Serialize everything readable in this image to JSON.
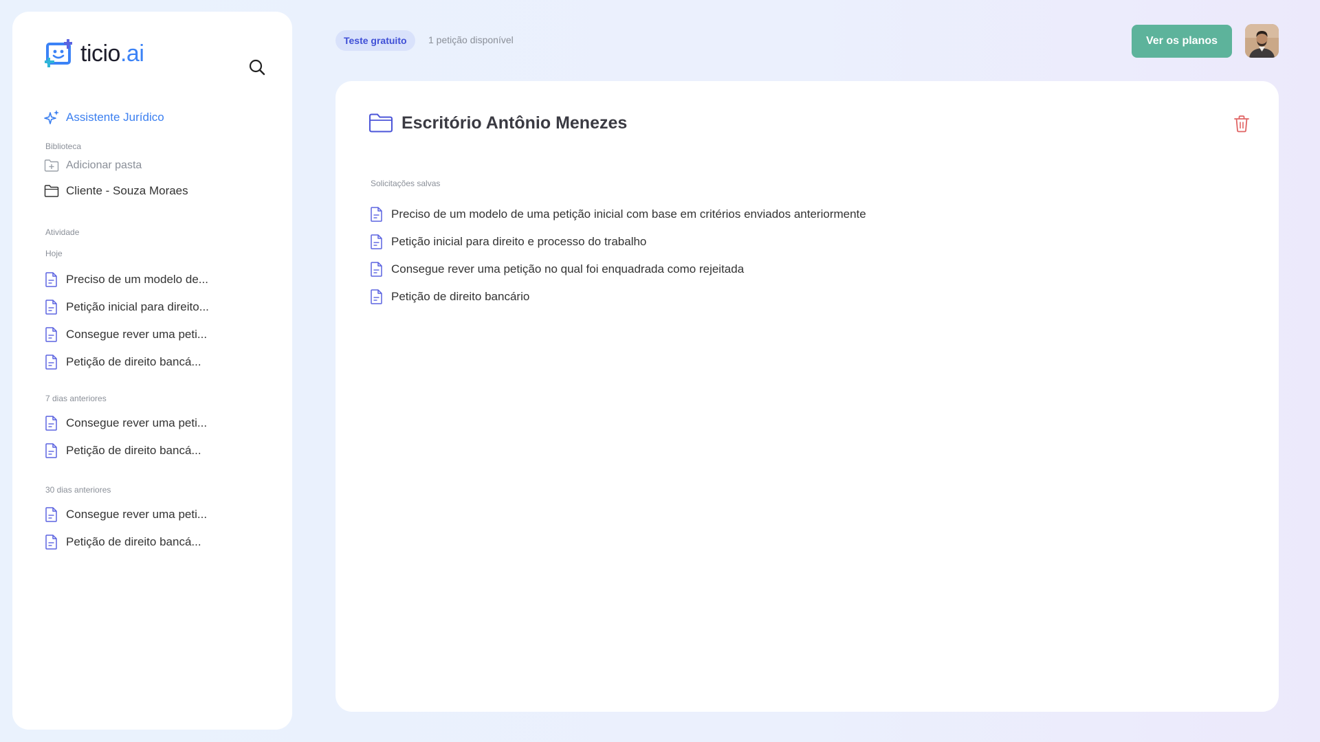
{
  "app": {
    "logo_text": "ticio",
    "logo_suffix": ".ai"
  },
  "colors": {
    "accent": "#3b7ff0",
    "doc_icon": "#5b63e0",
    "primary_button": "#5db39b",
    "danger": "#e06464",
    "badge_bg": "#d9e2fb",
    "badge_text": "#3f4fd6"
  },
  "sidebar": {
    "assistant_label": "Assistente Jurídico",
    "library_label": "Biblioteca",
    "add_folder_label": "Adicionar pasta",
    "folders": [
      "Cliente - Souza Moraes"
    ],
    "activity_label": "Atividade",
    "groups": [
      {
        "label": "Hoje",
        "items": [
          "Preciso de um modelo de...",
          "Petição inicial para direito...",
          "Consegue rever uma peti...",
          "Petição de direito bancá..."
        ]
      },
      {
        "label": "7 dias anteriores",
        "items": [
          "Consegue rever uma peti...",
          "Petição de direito bancá..."
        ]
      },
      {
        "label": "30 dias anteriores",
        "items": [
          "Consegue rever uma peti...",
          "Petição de direito bancá..."
        ]
      }
    ]
  },
  "header": {
    "trial_badge": "Teste gratuito",
    "availability": "1 petição disponível",
    "plans_button": "Ver os planos"
  },
  "main": {
    "folder_title": "Escritório Antônio Menezes",
    "saved_label": "Solicitações salvas",
    "saved_items": [
      "Preciso de um modelo de uma petição  inicial com base em critérios enviados anteriormente",
      "Petição inicial para direito e processo do trabalho",
      "Consegue rever uma petição no qual foi enquadrada como rejeitada",
      "Petição de direito bancário"
    ]
  }
}
